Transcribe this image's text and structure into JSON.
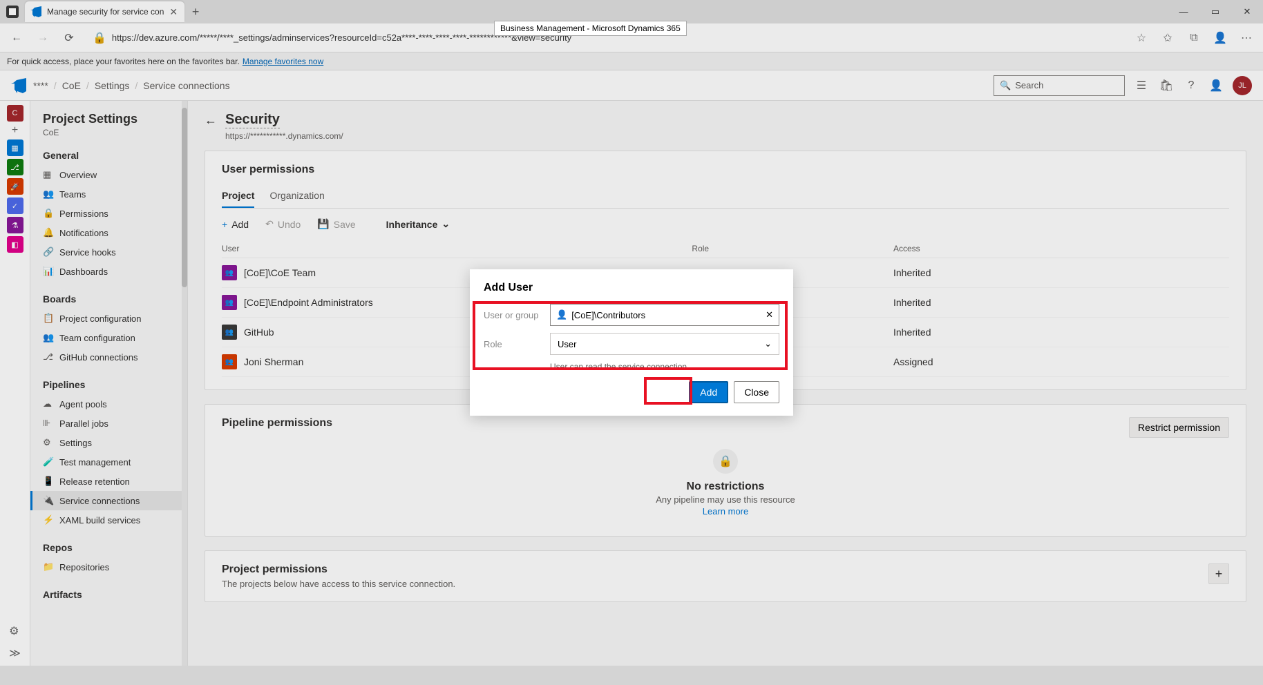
{
  "browser": {
    "tab_title": "Manage security for service con",
    "url_display": "https://dev.azure.com/*****/****_settings/adminservices?resourceId=c52a****-****-****-****-************&view=security",
    "hover_tooltip": "Business Management - Microsoft Dynamics 365",
    "fav_text": "For quick access, place your favorites here on the favorites bar.",
    "fav_link": "Manage favorites now"
  },
  "header": {
    "breadcrumbs": [
      "****",
      "CoE",
      "Settings",
      "Service connections"
    ],
    "search_placeholder": "Search",
    "avatar": "JL"
  },
  "sidebar": {
    "title": "Project Settings",
    "subtitle": "CoE",
    "sections": [
      {
        "label": "General",
        "items": [
          "Overview",
          "Teams",
          "Permissions",
          "Notifications",
          "Service hooks",
          "Dashboards"
        ]
      },
      {
        "label": "Boards",
        "items": [
          "Project configuration",
          "Team configuration",
          "GitHub connections"
        ]
      },
      {
        "label": "Pipelines",
        "items": [
          "Agent pools",
          "Parallel jobs",
          "Settings",
          "Test management",
          "Release retention",
          "Service connections",
          "XAML build services"
        ]
      },
      {
        "label": "Repos",
        "items": [
          "Repositories"
        ]
      },
      {
        "label": "Artifacts",
        "items": []
      }
    ],
    "active": "Service connections"
  },
  "page": {
    "title": "Security",
    "subtitle": "https://***********.dynamics.com/"
  },
  "user_permissions": {
    "title": "User permissions",
    "tabs": [
      "Project",
      "Organization"
    ],
    "active_tab": "Project",
    "toolbar": {
      "add": "Add",
      "undo": "Undo",
      "save": "Save",
      "inheritance": "Inheritance"
    },
    "columns": [
      "User",
      "Role",
      "Access"
    ],
    "rows": [
      {
        "name": "[CoE]\\CoE Team",
        "role": "",
        "access": "Inherited",
        "color": "#881798"
      },
      {
        "name": "[CoE]\\Endpoint Administrators",
        "role": "",
        "access": "Inherited",
        "color": "#881798"
      },
      {
        "name": "GitHub",
        "role": "",
        "access": "Inherited",
        "color": "#393939"
      },
      {
        "name": "Joni Sherman",
        "role": "",
        "access": "Assigned",
        "color": "#d83b01"
      }
    ]
  },
  "pipeline_permissions": {
    "title": "Pipeline permissions",
    "restrict": "Restrict permission",
    "empty_title": "No restrictions",
    "empty_msg": "Any pipeline may use this resource",
    "learn_more": "Learn more"
  },
  "project_permissions": {
    "title": "Project permissions",
    "desc": "The projects below have access to this service connection."
  },
  "modal": {
    "title": "Add User",
    "user_label": "User or group",
    "user_value": "[CoE]\\Contributors",
    "role_label": "Role",
    "role_value": "User",
    "help": "User can read the service connection.",
    "add": "Add",
    "close": "Close"
  }
}
